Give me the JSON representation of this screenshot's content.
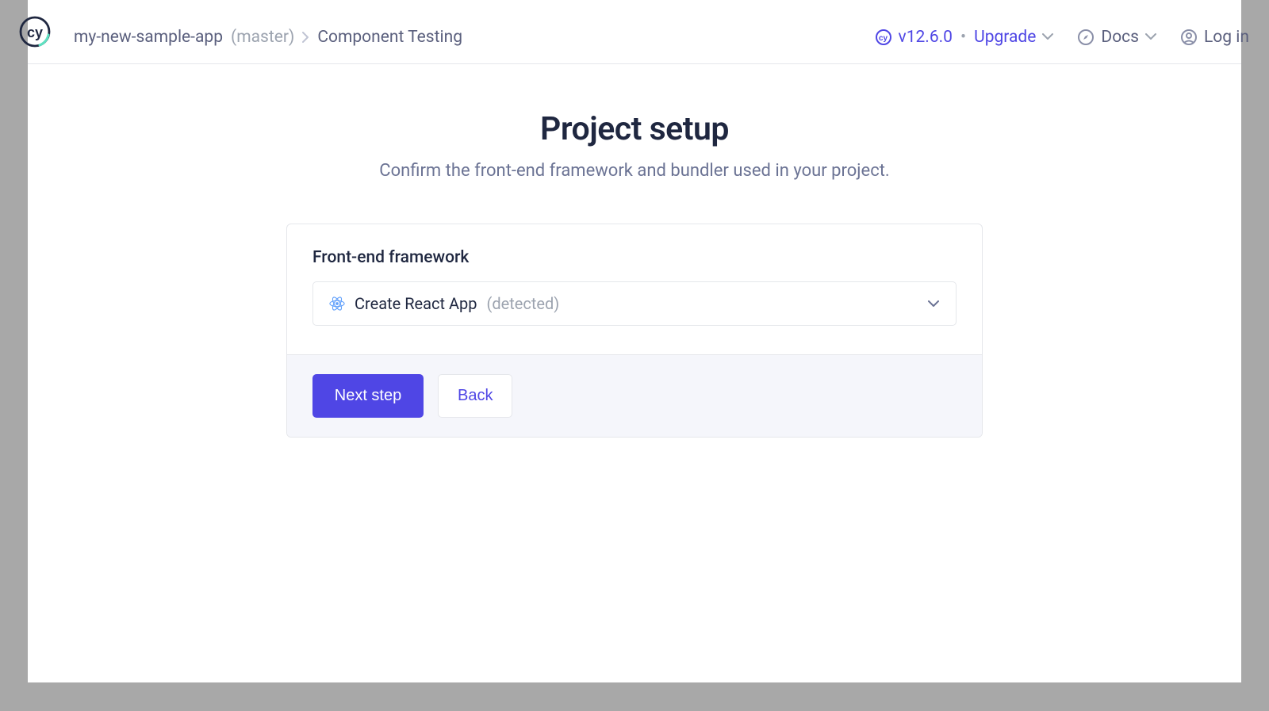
{
  "header": {
    "project_name": "my-new-sample-app",
    "branch": "(master)",
    "current_section": "Component Testing",
    "version": "v12.6.0",
    "upgrade_label": "Upgrade",
    "docs_label": "Docs",
    "login_label": "Log in"
  },
  "page": {
    "title": "Project setup",
    "subtitle": "Confirm the front-end framework and bundler used in your project."
  },
  "form": {
    "framework_label": "Front-end framework",
    "framework_value": "Create React App",
    "framework_detected": "(detected)"
  },
  "actions": {
    "next_label": "Next step",
    "back_label": "Back"
  }
}
